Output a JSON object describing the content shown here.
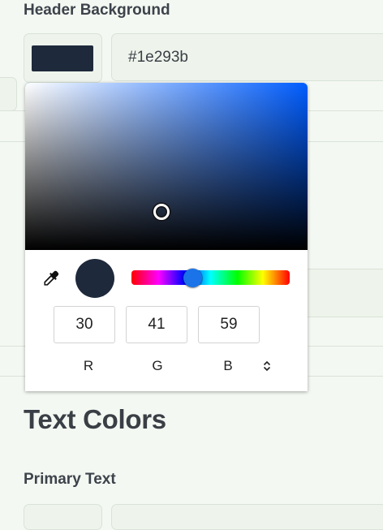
{
  "header_background": {
    "label": "Header Background",
    "hex_value": "#1e293b",
    "swatch_color": "#1e293b"
  },
  "color_picker": {
    "preview_color": "#1e293b",
    "rgb": {
      "r_value": "30",
      "g_value": "41",
      "b_value": "59",
      "r_label": "R",
      "g_label": "G",
      "b_label": "B"
    }
  },
  "text_colors": {
    "section_title": "Text Colors",
    "primary_text_label": "Primary Text"
  }
}
